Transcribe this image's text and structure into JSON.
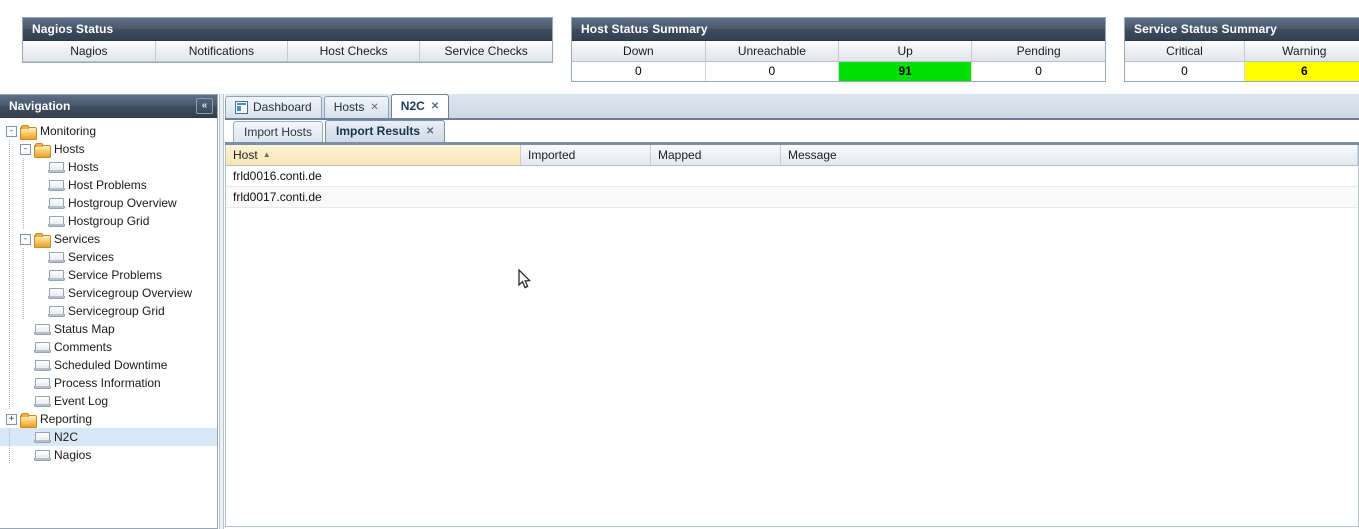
{
  "summary_panels": [
    {
      "id": "nagios-status",
      "title": "Nagios Status",
      "columns": [
        "Nagios",
        "Notifications",
        "Host Checks",
        "Service Checks"
      ],
      "values": [],
      "highlights": []
    },
    {
      "id": "host-status",
      "title": "Host Status Summary",
      "columns": [
        "Down",
        "Unreachable",
        "Up",
        "Pending"
      ],
      "values": [
        "0",
        "0",
        "91",
        "0"
      ],
      "highlights": [
        "",
        "",
        "up",
        ""
      ]
    },
    {
      "id": "service-status",
      "title": "Service Status Summary",
      "columns": [
        "Critical",
        "Warning",
        ""
      ],
      "values": [
        "0",
        "6",
        ""
      ],
      "highlights": [
        "",
        "warn",
        ""
      ]
    }
  ],
  "colors": {
    "up_green": "#00e000",
    "warning_yellow": "#ffff00",
    "panel_header": "#3e4c5e",
    "selected_row": "#d9e8f7",
    "sorted_column": "#f7e6b4"
  },
  "navigation": {
    "title": "Navigation",
    "collapse_icon": "«",
    "tree": [
      {
        "label": "Monitoring",
        "depth": 0,
        "type": "folder",
        "toggle": "-",
        "selected": false
      },
      {
        "label": "Hosts",
        "depth": 1,
        "type": "folder",
        "toggle": "-",
        "selected": false
      },
      {
        "label": "Hosts",
        "depth": 2,
        "type": "leaf",
        "toggle": "",
        "selected": false
      },
      {
        "label": "Host Problems",
        "depth": 2,
        "type": "leaf",
        "toggle": "",
        "selected": false
      },
      {
        "label": "Hostgroup Overview",
        "depth": 2,
        "type": "leaf",
        "toggle": "",
        "selected": false
      },
      {
        "label": "Hostgroup Grid",
        "depth": 2,
        "type": "leaf",
        "toggle": "",
        "selected": false
      },
      {
        "label": "Services",
        "depth": 1,
        "type": "folder",
        "toggle": "-",
        "selected": false
      },
      {
        "label": "Services",
        "depth": 2,
        "type": "leaf",
        "toggle": "",
        "selected": false
      },
      {
        "label": "Service Problems",
        "depth": 2,
        "type": "leaf",
        "toggle": "",
        "selected": false
      },
      {
        "label": "Servicegroup Overview",
        "depth": 2,
        "type": "leaf",
        "toggle": "",
        "selected": false
      },
      {
        "label": "Servicegroup Grid",
        "depth": 2,
        "type": "leaf",
        "toggle": "",
        "selected": false
      },
      {
        "label": "Status Map",
        "depth": 1,
        "type": "leaf",
        "toggle": "",
        "selected": false
      },
      {
        "label": "Comments",
        "depth": 1,
        "type": "leaf",
        "toggle": "",
        "selected": false
      },
      {
        "label": "Scheduled Downtime",
        "depth": 1,
        "type": "leaf",
        "toggle": "",
        "selected": false
      },
      {
        "label": "Process Information",
        "depth": 1,
        "type": "leaf",
        "toggle": "",
        "selected": false
      },
      {
        "label": "Event Log",
        "depth": 1,
        "type": "leaf",
        "toggle": "",
        "selected": false
      },
      {
        "label": "Reporting",
        "depth": 0,
        "type": "folder",
        "toggle": "+",
        "selected": false
      },
      {
        "label": "N2C",
        "depth": 1,
        "type": "leaf",
        "toggle": "",
        "selected": true
      },
      {
        "label": "Nagios",
        "depth": 1,
        "type": "leaf",
        "toggle": "",
        "selected": false
      }
    ]
  },
  "outer_tabs": [
    {
      "label": "Dashboard",
      "icon": "dashboard-icon",
      "active": false,
      "closable": false
    },
    {
      "label": "Hosts",
      "icon": "",
      "active": false,
      "closable": true
    },
    {
      "label": "N2C",
      "icon": "",
      "active": true,
      "closable": true
    }
  ],
  "inner_tabs": [
    {
      "label": "Import Hosts",
      "active": false,
      "closable": false
    },
    {
      "label": "Import Results",
      "active": true,
      "closable": true
    }
  ],
  "grid": {
    "columns": [
      {
        "label": "Host",
        "sorted": true,
        "sort_dir": "▲"
      },
      {
        "label": "Imported",
        "sorted": false,
        "sort_dir": ""
      },
      {
        "label": "Mapped",
        "sorted": false,
        "sort_dir": ""
      },
      {
        "label": "Message",
        "sorted": false,
        "sort_dir": ""
      }
    ],
    "rows": [
      {
        "host": "frld0016.conti.de",
        "imported": "",
        "mapped": "",
        "message": ""
      },
      {
        "host": "frld0017.conti.de",
        "imported": "",
        "mapped": "",
        "message": ""
      }
    ]
  },
  "close_glyph": "✕"
}
